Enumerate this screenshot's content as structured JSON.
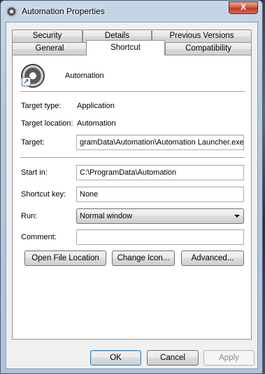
{
  "window": {
    "title": "Automation Properties",
    "close_label": "X"
  },
  "tabs": {
    "row1": [
      "Security",
      "Details",
      "Previous Versions"
    ],
    "row2": [
      "General",
      "Shortcut",
      "Compatibility"
    ],
    "active": "Shortcut"
  },
  "shortcut": {
    "name": "Automation",
    "target_type_label": "Target type:",
    "target_type_value": "Application",
    "target_location_label": "Target location:",
    "target_location_value": "Automation",
    "target_label": "Target:",
    "target_value": "gramData\\Automation\\Automation Launcher.exe\"",
    "start_in_label": "Start in:",
    "start_in_value": "C:\\ProgramData\\Automation",
    "shortcut_key_label": "Shortcut key:",
    "shortcut_key_value": "None",
    "run_label": "Run:",
    "run_value": "Normal window",
    "comment_label": "Comment:",
    "comment_value": ""
  },
  "buttons": {
    "open_file_location": "Open File Location",
    "change_icon": "Change Icon...",
    "advanced": "Advanced...",
    "ok": "OK",
    "cancel": "Cancel",
    "apply": "Apply"
  },
  "icons": {
    "app": "automation-app-icon",
    "shortcut_overlay": "shortcut-arrow-icon"
  },
  "shortcut_overlay_glyph": "↗"
}
